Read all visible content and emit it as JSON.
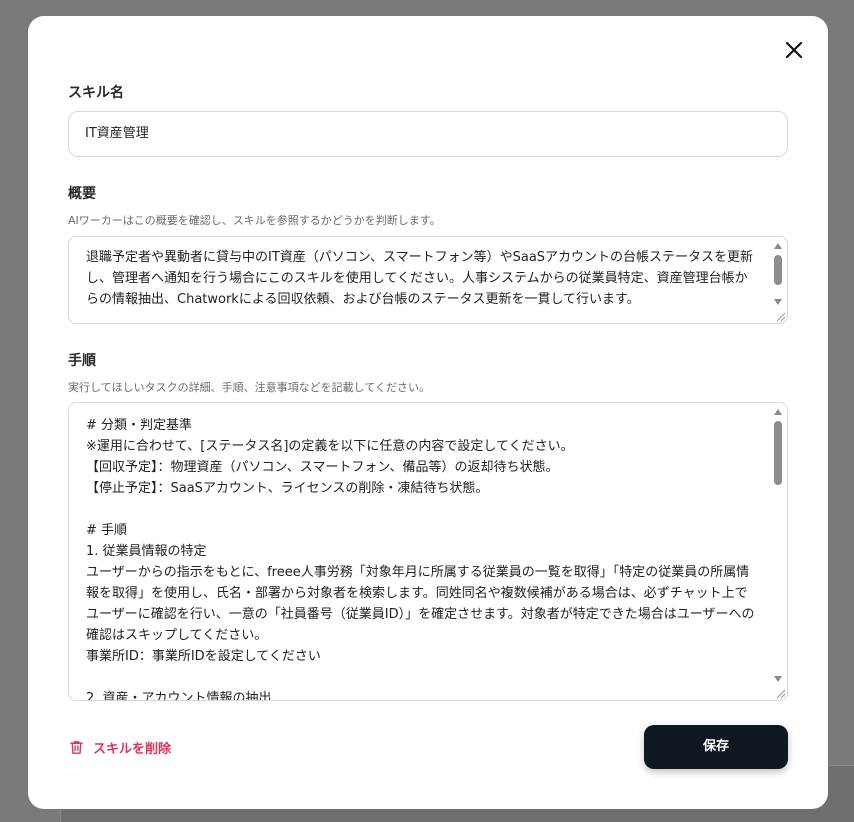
{
  "modal": {
    "close_icon": "close-icon"
  },
  "skill_name": {
    "label": "スキル名",
    "value": "IT資産管理"
  },
  "overview": {
    "label": "概要",
    "hint": "AIワーカーはこの概要を確認し、スキルを参照するかどうかを判断します。",
    "value": "退職予定者や異動者に貸与中のIT資産（パソコン、スマートフォン等）やSaaSアカウントの台帳ステータスを更新し、管理者へ通知を行う場合にこのスキルを使用してください。人事システムからの従業員特定、資産管理台帳からの情報抽出、Chatworkによる回収依頼、および台帳のステータス更新を一貫して行います。"
  },
  "procedure": {
    "label": "手順",
    "hint": "実行してほしいタスクの詳細、手順、注意事項などを記載してください。",
    "value": "# 分類・判定基準\n※運用に合わせて、[ステータス名]の定義を以下に任意の内容で設定してください。\n【回収予定】：物理資産（パソコン、スマートフォン、備品等）の返却待ち状態。\n【停止予定】：SaaSアカウント、ライセンスの削除・凍結待ち状態。\n\n# 手順\n1. 従業員情報の特定\nユーザーからの指示をもとに、freee人事労務「対象年月に所属する従業員の一覧を取得」「特定の従業員の所属情報を取得」を使用し、氏名・部署から対象者を検索します。同姓同名や複数候補がある場合は、必ずチャット上でユーザーに確認を行い、一意の「社員番号（従業員ID）」を確定させます。対象者が特定できた場合はユーザーへの確認はスキップしてください。\n事業所ID：事業所IDを設定してください\n\n2. 資産・アカウント情報の抽出"
  },
  "actions": {
    "delete_label": "スキルを削除",
    "delete_icon": "trash-icon",
    "save_label": "保存"
  },
  "colors": {
    "danger": "#e0345a",
    "primary_button": "#0f1720"
  }
}
